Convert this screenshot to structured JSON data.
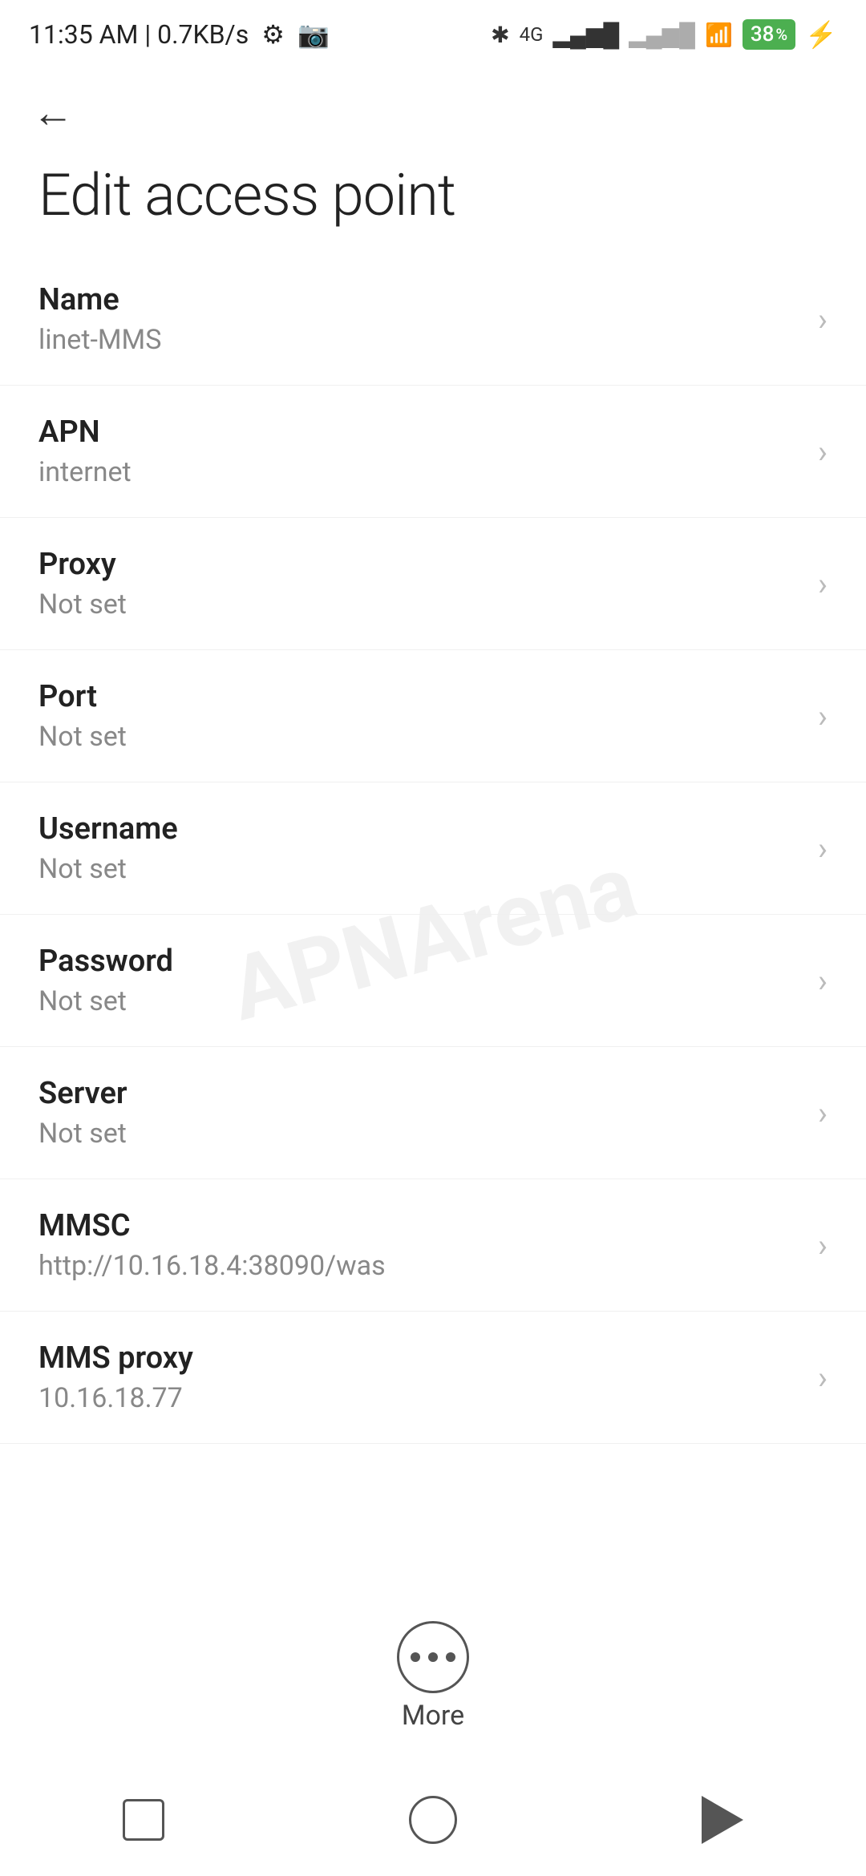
{
  "statusBar": {
    "time": "11:35 AM | 0.7KB/s",
    "battery": "38"
  },
  "header": {
    "back_label": "←",
    "title": "Edit access point"
  },
  "settings": {
    "items": [
      {
        "label": "Name",
        "value": "linet-MMS"
      },
      {
        "label": "APN",
        "value": "internet"
      },
      {
        "label": "Proxy",
        "value": "Not set"
      },
      {
        "label": "Port",
        "value": "Not set"
      },
      {
        "label": "Username",
        "value": "Not set"
      },
      {
        "label": "Password",
        "value": "Not set"
      },
      {
        "label": "Server",
        "value": "Not set"
      },
      {
        "label": "MMSC",
        "value": "http://10.16.18.4:38090/was"
      },
      {
        "label": "MMS proxy",
        "value": "10.16.18.77"
      }
    ]
  },
  "watermark": "APNArena",
  "more": {
    "label": "More"
  },
  "navbar": {
    "recent_label": "recent",
    "home_label": "home",
    "back_label": "back"
  }
}
